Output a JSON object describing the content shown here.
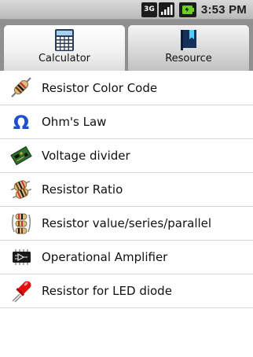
{
  "status_bar": {
    "network_label": "3G",
    "time": "3:53 PM",
    "icons": [
      "3g-icon",
      "signal-icon",
      "battery-icon"
    ]
  },
  "tabs": [
    {
      "label": "Calculator",
      "icon": "calculator-icon",
      "selected": true
    },
    {
      "label": "Resource",
      "icon": "book-icon",
      "selected": false
    }
  ],
  "menu": {
    "items": [
      {
        "label": "Resistor Color Code",
        "icon": "resistor-icon"
      },
      {
        "label": "Ohm's Law",
        "icon": "omega-icon"
      },
      {
        "label": "Voltage divider",
        "icon": "circuit-board-icon"
      },
      {
        "label": "Resistor Ratio",
        "icon": "resistor-pair-icon"
      },
      {
        "label": "Resistor value/series/parallel",
        "icon": "resistor-network-icon"
      },
      {
        "label": "Operational Amplifier",
        "icon": "op-amp-chip-icon"
      },
      {
        "label": "Resistor for LED diode",
        "icon": "led-icon"
      }
    ]
  },
  "colors": {
    "status_bar": "#c8c8c8",
    "tab_bar": "#909090",
    "list_background": "#ffffff",
    "divider": "#d6d6d6",
    "omega_blue": "#1f4fd1",
    "led_red": "#e01010"
  }
}
